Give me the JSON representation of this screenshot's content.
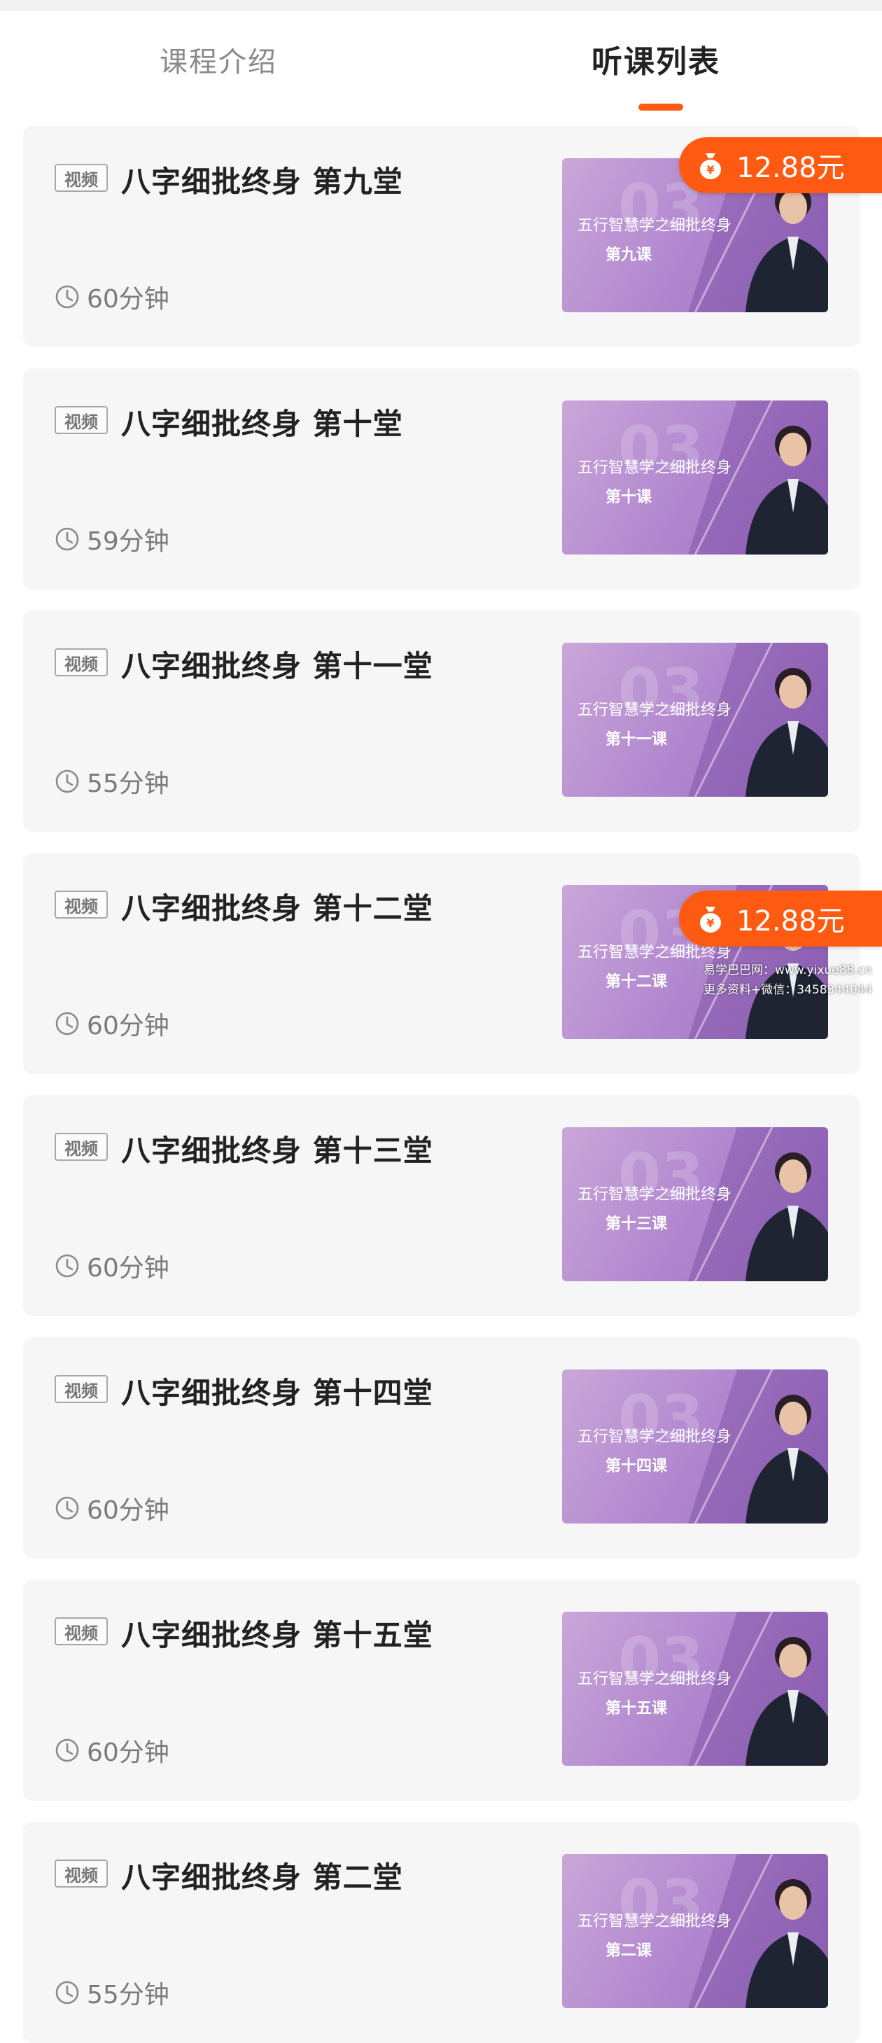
{
  "tabs": {
    "intro": "课程介绍",
    "list": "听课列表"
  },
  "colors": {
    "accent": "#ff5a12",
    "card_bg": "#f6f6f7",
    "thumb": "#b38ad0"
  },
  "courses": [
    {
      "tag": "视频",
      "title": "八字细批终身 第九堂",
      "duration": "60分钟",
      "thumb_title": "五行智慧学之细批终身",
      "thumb_lesson": "第九课",
      "thumb_num": "03"
    },
    {
      "tag": "视频",
      "title": "八字细批终身 第十堂",
      "duration": "59分钟",
      "thumb_title": "五行智慧学之细批终身",
      "thumb_lesson": "第十课",
      "thumb_num": "03"
    },
    {
      "tag": "视频",
      "title": "八字细批终身 第十一堂",
      "duration": "55分钟",
      "thumb_title": "五行智慧学之细批终身",
      "thumb_lesson": "第十一课",
      "thumb_num": "03"
    },
    {
      "tag": "视频",
      "title": "八字细批终身 第十二堂",
      "duration": "60分钟",
      "thumb_title": "五行智慧学之细批终身",
      "thumb_lesson": "第十二课",
      "thumb_num": "03"
    },
    {
      "tag": "视频",
      "title": "八字细批终身 第十三堂",
      "duration": "60分钟",
      "thumb_title": "五行智慧学之细批终身",
      "thumb_lesson": "第十三课",
      "thumb_num": "03"
    },
    {
      "tag": "视频",
      "title": "八字细批终身 第十四堂",
      "duration": "60分钟",
      "thumb_title": "五行智慧学之细批终身",
      "thumb_lesson": "第十四课",
      "thumb_num": "03"
    },
    {
      "tag": "视频",
      "title": "八字细批终身 第十五堂",
      "duration": "60分钟",
      "thumb_title": "五行智慧学之细批终身",
      "thumb_lesson": "第十五课",
      "thumb_num": "03"
    },
    {
      "tag": "视频",
      "title": "八字细批终身 第二堂",
      "duration": "55分钟",
      "thumb_title": "五行智慧学之细批终身",
      "thumb_lesson": "第二课",
      "thumb_num": "03"
    }
  ],
  "price_badges": [
    {
      "label": "12.88元",
      "icon": "money-bag-icon"
    },
    {
      "label": "12.88元",
      "icon": "money-bag-icon"
    }
  ],
  "watermark": {
    "line1": "易学巴巴网：www.yixue88.cn",
    "line2": "更多资料+微信：3458344044"
  }
}
